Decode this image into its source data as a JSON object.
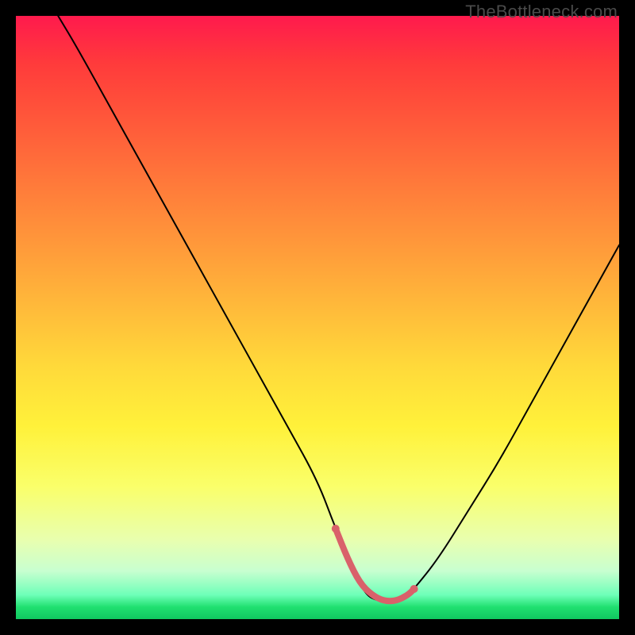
{
  "watermark": {
    "text": "TheBottleneck.com"
  },
  "chart_data": {
    "type": "line",
    "title": "",
    "xlabel": "",
    "ylabel": "",
    "xlim": [
      0,
      100
    ],
    "ylim": [
      0,
      100
    ],
    "grid": false,
    "series": [
      {
        "name": "curve",
        "color": "#000000",
        "stroke_width": 2,
        "x": [
          7,
          10,
          15,
          20,
          25,
          30,
          35,
          40,
          45,
          50,
          53,
          56,
          58,
          60,
          62,
          64,
          66,
          70,
          75,
          80,
          85,
          90,
          95,
          100
        ],
        "values": [
          100,
          95,
          86,
          77,
          68,
          59,
          50,
          41,
          32,
          23,
          15,
          8,
          4,
          3,
          3,
          3,
          5,
          10,
          18,
          26,
          35,
          44,
          53,
          62
        ]
      },
      {
        "name": "highlight-band",
        "color": "#d9616a",
        "stroke_width": 8,
        "x": [
          53,
          55,
          57,
          59,
          61,
          63,
          65,
          66
        ],
        "values": [
          15,
          10,
          6,
          4,
          3,
          3,
          4,
          5
        ]
      }
    ],
    "annotations": []
  }
}
